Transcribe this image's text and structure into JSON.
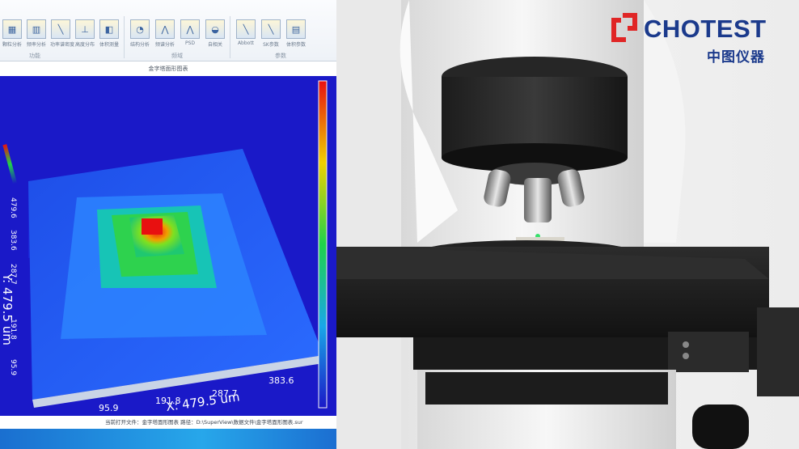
{
  "ribbon": {
    "tools": [
      {
        "label": "颗粒分析",
        "icon": "particle-analysis-icon"
      },
      {
        "label": "频率分析",
        "icon": "frequency-analysis-icon"
      },
      {
        "label": "功率谱密度",
        "icon": "psd-curve-icon"
      },
      {
        "label": "高度分布",
        "icon": "height-distribution-icon"
      },
      {
        "label": "体积测量",
        "icon": "volume-measurement-icon"
      },
      {
        "label": "结构分析",
        "icon": "structure-analysis-icon"
      },
      {
        "label": "频谱分析",
        "icon": "spectrum-analysis-icon"
      },
      {
        "label": "PSD",
        "icon": "psd-icon"
      },
      {
        "label": "自相关",
        "icon": "autocorrelation-icon"
      },
      {
        "label": "Abbott",
        "icon": "abbott-curve-icon"
      },
      {
        "label": "SK参数",
        "icon": "sk-parameters-icon"
      },
      {
        "label": "体积参数",
        "icon": "volume-parameters-icon"
      }
    ],
    "groups": [
      "功能",
      "频域",
      "参数"
    ]
  },
  "graph": {
    "title": "金字塔面形图表",
    "x_axis_label": "X: 479.5 um",
    "y_axis_label": "Y: 479.5 um",
    "x_ticks": [
      "95.9",
      "191.8",
      "287.7",
      "383.6"
    ],
    "y_ticks": [
      "479.6",
      "383.6",
      "287.7",
      "191.8",
      "95.9"
    ],
    "colors": {
      "low": "#1a19c8",
      "mid": "#1fd34a",
      "high": "#e81010"
    }
  },
  "status": {
    "text": "当前打开文件：金字塔面形图表    路径：D:\\SuperView\\数据文件\\金字塔面形图表.sur"
  },
  "brand": {
    "name": "CHOTEST",
    "subtitle": "中图仪器",
    "color": "#1b3a8c",
    "accent": "#e02626"
  }
}
